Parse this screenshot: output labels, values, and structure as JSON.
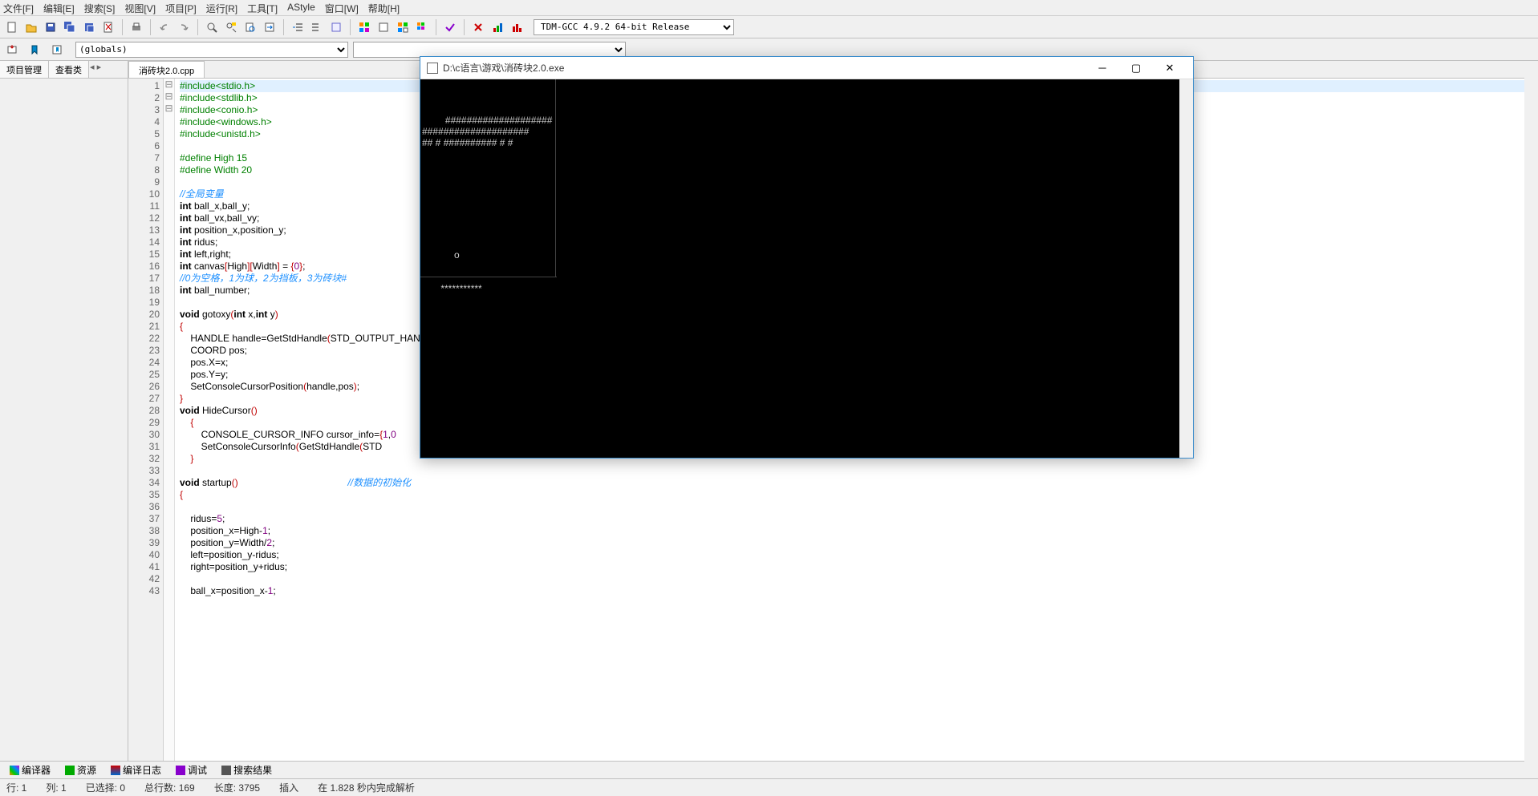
{
  "menu": {
    "file": "文件[F]",
    "edit": "编辑[E]",
    "search": "搜索[S]",
    "view": "视图[V]",
    "project": "项目[P]",
    "run": "运行[R]",
    "tools": "工具[T]",
    "astyle": "AStyle",
    "window": "窗口[W]",
    "help": "帮助[H]"
  },
  "compiler_combo": "TDM-GCC 4.9.2 64-bit Release",
  "scope_combo": "(globals)",
  "side": {
    "tab1": "项目管理",
    "tab2": "查看类",
    "nav": "◂ ▸"
  },
  "filetab": "消砖块2.0.cpp",
  "code": {
    "lines": [
      {
        "n": 1,
        "html": "<span class='pp'>#include&lt;stdio.h&gt;</span>",
        "hl": true
      },
      {
        "n": 2,
        "html": "<span class='pp'>#include&lt;stdlib.h&gt;</span>"
      },
      {
        "n": 3,
        "html": "<span class='pp'>#include&lt;conio.h&gt;</span>"
      },
      {
        "n": 4,
        "html": "<span class='pp'>#include&lt;windows.h&gt;</span>"
      },
      {
        "n": 5,
        "html": "<span class='pp'>#include&lt;unistd.h&gt;</span>"
      },
      {
        "n": 6,
        "html": ""
      },
      {
        "n": 7,
        "html": "<span class='pp'>#define High 15</span>"
      },
      {
        "n": 8,
        "html": "<span class='pp'>#define Width 20</span>"
      },
      {
        "n": 9,
        "html": ""
      },
      {
        "n": 10,
        "html": "<span class='cmt'>//全局变量</span>"
      },
      {
        "n": 11,
        "html": "<span class='kw'>int</span> ball_x,ball_y;"
      },
      {
        "n": 12,
        "html": "<span class='kw'>int</span> ball_vx,ball_vy;"
      },
      {
        "n": 13,
        "html": "<span class='kw'>int</span> position_x,position_y;"
      },
      {
        "n": 14,
        "html": "<span class='kw'>int</span> ridus;"
      },
      {
        "n": 15,
        "html": "<span class='kw'>int</span> left,right;"
      },
      {
        "n": 16,
        "html": "<span class='kw'>int</span> canvas<span class='paren'>[</span>High<span class='paren'>][</span>Width<span class='paren'>]</span> = <span class='paren'>{</span><span class='num'>0</span><span class='paren'>}</span>;"
      },
      {
        "n": 17,
        "html": "<span class='cmt'>//0为空格，1为球，2为挡板，3为砖块#</span>"
      },
      {
        "n": 18,
        "html": "<span class='kw'>int</span> ball_number;"
      },
      {
        "n": 19,
        "html": ""
      },
      {
        "n": 20,
        "html": "<span class='kw'>void</span> gotoxy<span class='paren'>(</span><span class='kw'>int</span> x,<span class='kw'>int</span> y<span class='paren'>)</span>"
      },
      {
        "n": 21,
        "html": "<span class='paren'>{</span>",
        "fold": "⊟"
      },
      {
        "n": 22,
        "html": "    HANDLE handle=GetStdHandle<span class='paren'>(</span>STD_OUTPUT_HAN"
      },
      {
        "n": 23,
        "html": "    COORD pos;"
      },
      {
        "n": 24,
        "html": "    pos.X=x;"
      },
      {
        "n": 25,
        "html": "    pos.Y=y;"
      },
      {
        "n": 26,
        "html": "    SetConsoleCursorPosition<span class='paren'>(</span>handle,pos<span class='paren'>)</span>;"
      },
      {
        "n": 27,
        "html": "<span class='paren'>}</span>"
      },
      {
        "n": 28,
        "html": "<span class='kw'>void</span> HideCursor<span class='paren'>()</span>"
      },
      {
        "n": 29,
        "html": "    <span class='paren'>{</span>",
        "fold": "⊟"
      },
      {
        "n": 30,
        "html": "        CONSOLE_CURSOR_INFO cursor_info=<span class='paren'>{</span><span class='num'>1</span>,<span class='num'>0</span>"
      },
      {
        "n": 31,
        "html": "        SetConsoleCursorInfo<span class='paren'>(</span>GetStdHandle<span class='paren'>(</span>STD"
      },
      {
        "n": 32,
        "html": "    <span class='paren'>}</span>"
      },
      {
        "n": 33,
        "html": ""
      },
      {
        "n": 34,
        "html": "<span class='kw'>void</span> startup<span class='paren'>()</span>                                         <span class='cmt'>//数据的初始化</span>"
      },
      {
        "n": 35,
        "html": "<span class='paren'>{</span>",
        "fold": "⊟"
      },
      {
        "n": 36,
        "html": ""
      },
      {
        "n": 37,
        "html": "    ridus=<span class='num'>5</span>;"
      },
      {
        "n": 38,
        "html": "    position_x=High-<span class='num'>1</span>;"
      },
      {
        "n": 39,
        "html": "    position_y=Width/<span class='num'>2</span>;"
      },
      {
        "n": 40,
        "html": "    left=position_y-ridus;"
      },
      {
        "n": 41,
        "html": "    right=position_y+ridus;"
      },
      {
        "n": 42,
        "html": ""
      },
      {
        "n": 43,
        "html": "    ball_x=position_x-<span class='num'>1</span>;"
      }
    ]
  },
  "console": {
    "title": "D:\\c语言\\游戏\\消砖块2.0.exe",
    "content": "####################\n####################\n## # ########## # #\n\n\n\n\n\n\n\n\n\n            o\n\n\n       ***********"
  },
  "bottom": {
    "compiler": "编译器",
    "resource": "资源",
    "log": "编译日志",
    "debug": "调试",
    "search": "搜索结果"
  },
  "status": {
    "line": "行:  1",
    "col": "列:  1",
    "sel": "已选择:  0",
    "total": "总行数:  169",
    "len": "长度:  3795",
    "ins": "插入",
    "parse": "在 1.828 秒内完成解析"
  }
}
